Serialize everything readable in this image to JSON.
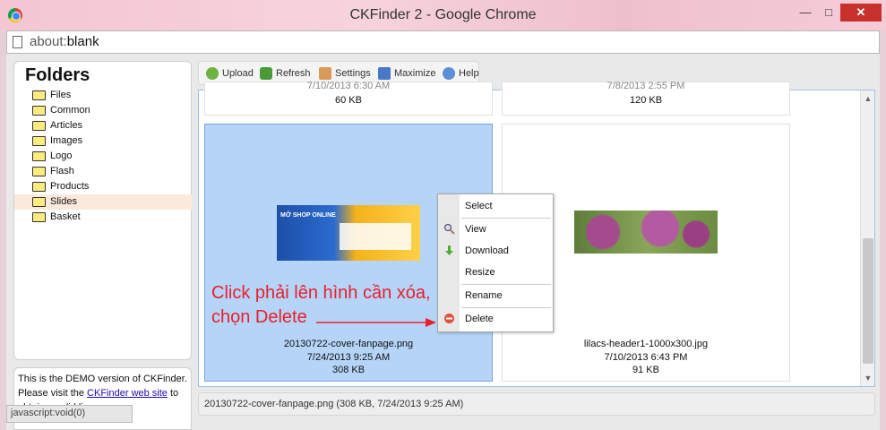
{
  "window": {
    "title": "CKFinder 2 - Google Chrome",
    "minimize": "—",
    "maximize": "□",
    "close": "✕"
  },
  "address": {
    "prefix": "about:",
    "page": "blank"
  },
  "folders": {
    "title": "Folders",
    "items": [
      {
        "label": "Files"
      },
      {
        "label": "Common"
      },
      {
        "label": "Articles"
      },
      {
        "label": "Images"
      },
      {
        "label": "Logo"
      },
      {
        "label": "Flash"
      },
      {
        "label": "Products"
      },
      {
        "label": "Slides",
        "selected": true
      },
      {
        "label": "Basket"
      }
    ]
  },
  "demo": {
    "line1": "This is the DEMO version of CKFinder.",
    "line2_prefix": "Please visit the ",
    "link": "CKFinder web site",
    "line2_suffix": " to",
    "line3": "obtain a valid license."
  },
  "status_link": "javascript:void(0)",
  "toolbar": {
    "upload": "Upload",
    "refresh": "Refresh",
    "settings": "Settings",
    "maximize": "Maximize",
    "help": "Help"
  },
  "files_top": [
    {
      "date": "7/10/2013 6:30 AM",
      "size": "60 KB"
    },
    {
      "date": "7/8/2013 2:55 PM",
      "size": "120 KB"
    }
  ],
  "files": [
    {
      "name": "20130722-cover-fanpage.png",
      "date": "7/24/2013 9:25 AM",
      "size": "308 KB",
      "selected": true,
      "banner_text": "MỞ SHOP ONLINE"
    },
    {
      "name": "lilacs-header1-1000x300.jpg",
      "date": "7/10/2013 6:43 PM",
      "size": "91 KB"
    }
  ],
  "context_menu": {
    "select": "Select",
    "view": "View",
    "download": "Download",
    "resize": "Resize",
    "rename": "Rename",
    "delete": "Delete"
  },
  "annotation": {
    "line1": "Click phải lên hình cần xóa,",
    "line2": "chọn Delete",
    "color": "#e8202a"
  },
  "info_bar": "20130722-cover-fanpage.png (308 KB, 7/24/2013 9:25 AM)"
}
